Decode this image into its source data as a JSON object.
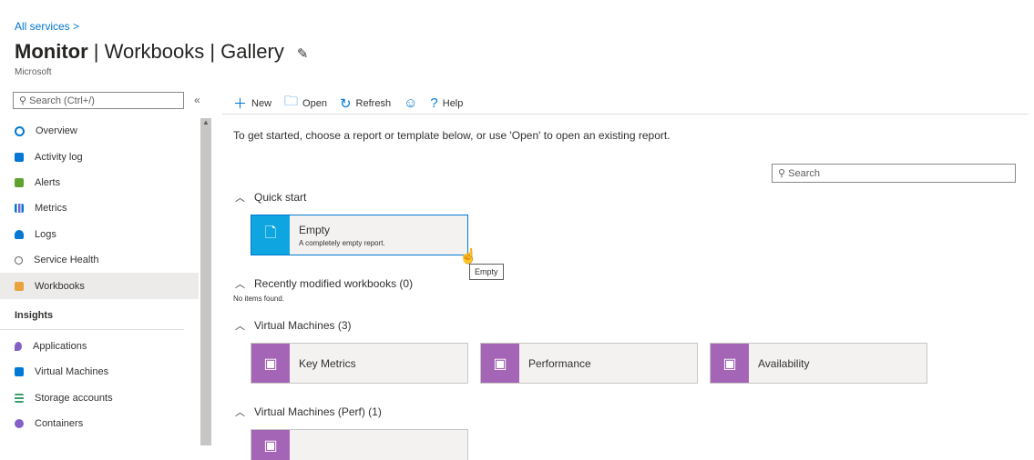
{
  "breadcrumb": "All services >",
  "header": {
    "title_bold": "Monitor",
    "title_rest": " | Workbooks | Gallery",
    "subtitle": "Microsoft"
  },
  "sidebar": {
    "search_placeholder": "Search (Ctrl+/)",
    "collapse_glyph": "«",
    "items": [
      {
        "label": "Overview",
        "icon": "overview-icon",
        "color": "#0078d4"
      },
      {
        "label": "Activity log",
        "icon": "activity-log-icon",
        "color": "#0078d4"
      },
      {
        "label": "Alerts",
        "icon": "alerts-icon",
        "color": "#5ea32f"
      },
      {
        "label": "Metrics",
        "icon": "metrics-icon",
        "color": "#0078d4"
      },
      {
        "label": "Logs",
        "icon": "logs-icon",
        "color": "#0078d4"
      },
      {
        "label": "Service Health",
        "icon": "service-health-icon",
        "color": "#605e5c"
      },
      {
        "label": "Workbooks",
        "icon": "workbooks-icon",
        "color": "#e8a33d"
      }
    ],
    "insights_header": "Insights",
    "insights_items": [
      {
        "label": "Applications",
        "icon": "applications-icon",
        "color": "#8661c5"
      },
      {
        "label": "Virtual Machines",
        "icon": "virtual-machines-icon",
        "color": "#0078d4"
      },
      {
        "label": "Storage accounts",
        "icon": "storage-accounts-icon",
        "color": "#3a9e6b"
      },
      {
        "label": "Containers",
        "icon": "containers-icon",
        "color": "#8661c5"
      }
    ]
  },
  "toolbar": {
    "new": "New",
    "open": "Open",
    "refresh": "Refresh",
    "help": "Help"
  },
  "intro": "To get started, choose a report or template below, or use 'Open' to open an existing report.",
  "gallery_search_placeholder": "Search",
  "sections": {
    "quick_start": "Quick start",
    "recent": "Recently modified workbooks (0)",
    "no_items": "No items found.",
    "vm": "Virtual Machines (3)",
    "vm_perf": "Virtual Machines (Perf) (1)"
  },
  "tiles": {
    "empty": {
      "title": "Empty",
      "desc": "A completely empty report."
    },
    "vm": [
      "Key Metrics",
      "Performance",
      "Availability"
    ]
  },
  "tooltip": "Empty",
  "colors": {
    "accent": "#0078d4",
    "empty_tile": "#0ea5e0",
    "template_tile": "#a565b6"
  }
}
